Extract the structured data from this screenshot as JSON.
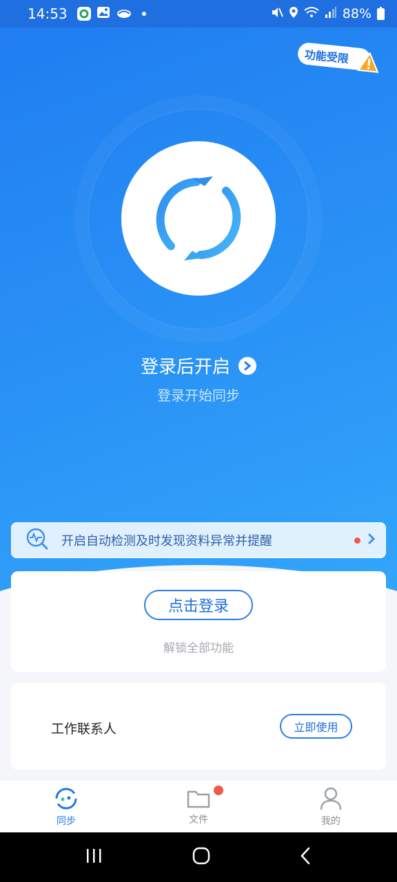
{
  "status_bar": {
    "time": "14:53",
    "battery": "88%"
  },
  "header": {
    "limit_badge": "功能受限"
  },
  "hero": {
    "title": "登录后开启",
    "subtitle": "登录开始同步"
  },
  "notice": {
    "text": "开启自动检测及时发现资料异常并提醒"
  },
  "login_card": {
    "button_label": "点击登录",
    "hint": "解锁全部功能"
  },
  "contact_card": {
    "label": "工作联系人",
    "button_label": "立即使用"
  },
  "tabs": [
    {
      "label": "同步",
      "icon": "sync-icon",
      "active": true
    },
    {
      "label": "文件",
      "icon": "folder-icon",
      "badge": true
    },
    {
      "label": "我的",
      "icon": "person-icon"
    }
  ],
  "colors": {
    "primary": "#1e78e6",
    "badge_red": "#f05a4a",
    "warning": "#f5a623"
  }
}
